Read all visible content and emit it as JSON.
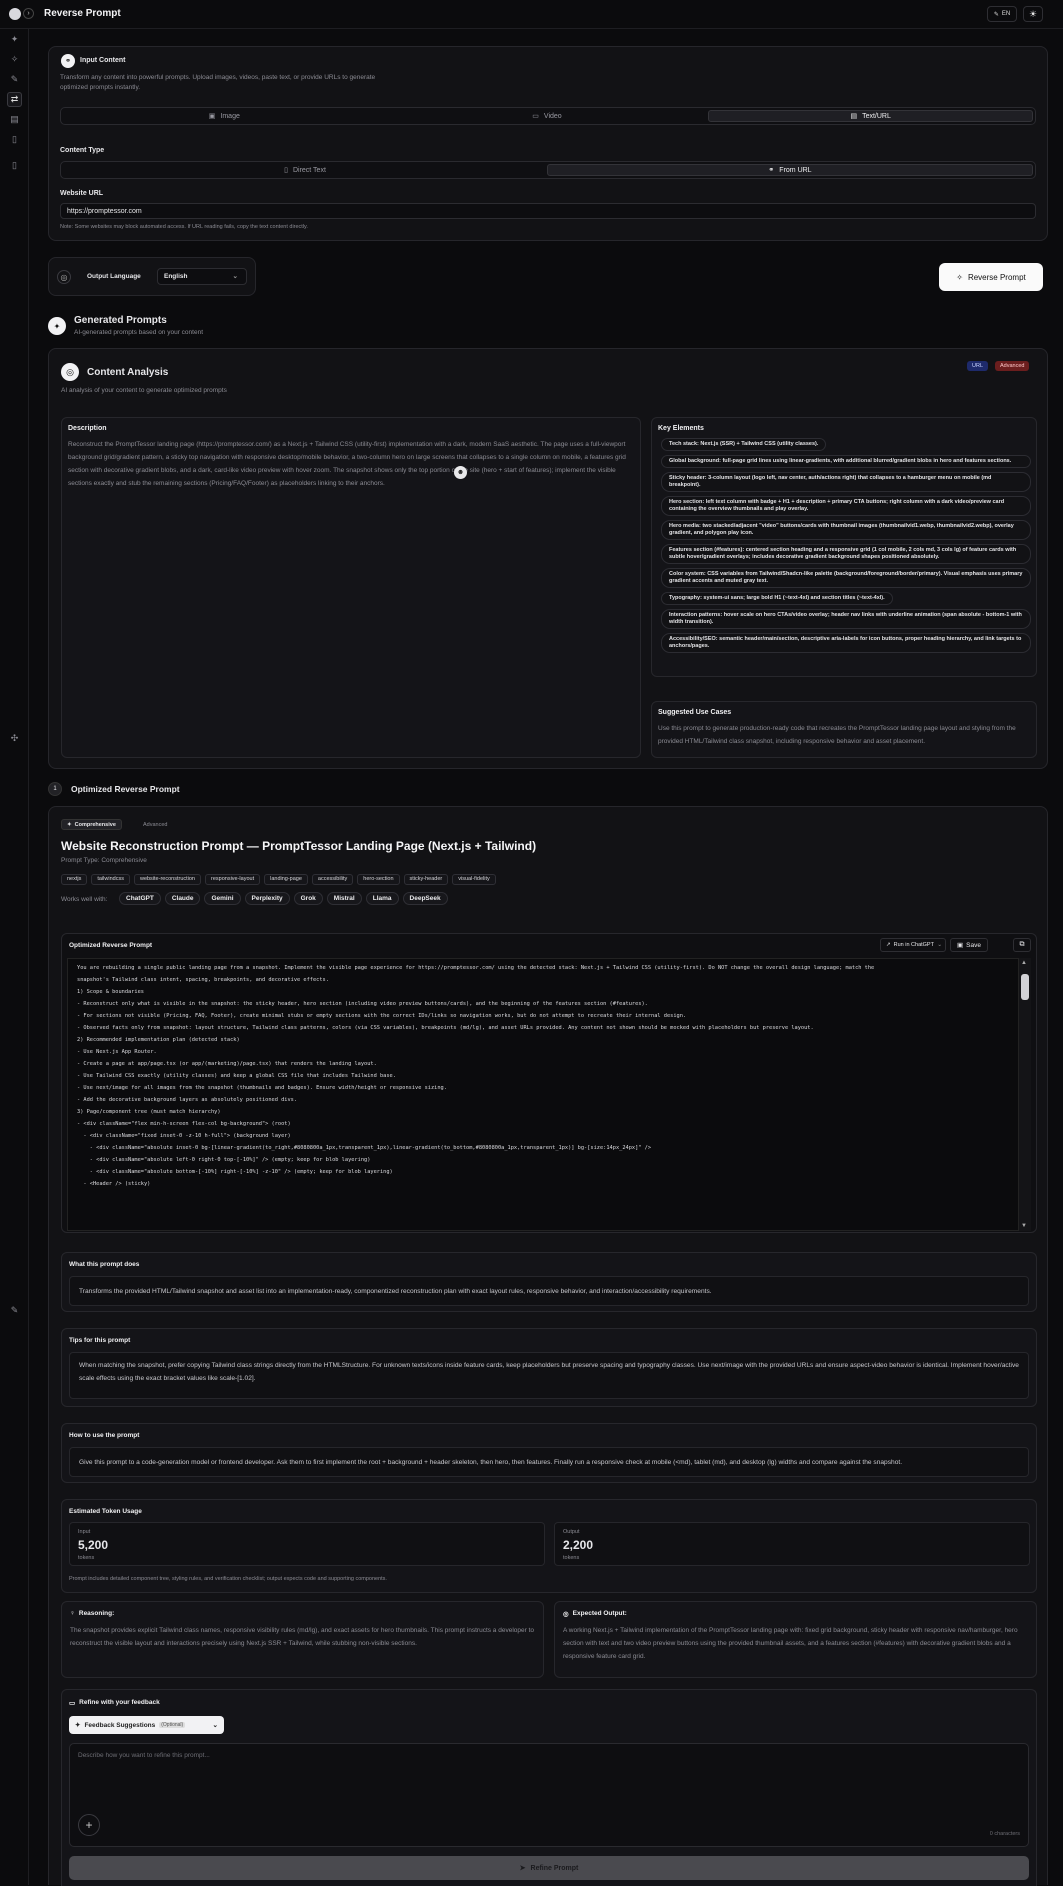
{
  "app": {
    "title": "Reverse Prompt",
    "lang_button": "EN"
  },
  "input_content": {
    "title": "Input Content",
    "description": "Transform any content into powerful prompts. Upload images, videos, paste text, or provide URLs to generate optimized prompts instantly.",
    "tabs": [
      {
        "label": "Image"
      },
      {
        "label": "Video"
      },
      {
        "label": "Text/URL"
      }
    ],
    "content_type_label": "Content Type",
    "content_type_tabs": [
      {
        "label": "Direct Text"
      },
      {
        "label": "From URL"
      }
    ],
    "website_url_label": "Website URL",
    "website_url_value": "https://promptessor.com",
    "note": "Note: Some websites may block automated access. If URL reading fails, copy the text content directly."
  },
  "output_language": {
    "label": "Output Language",
    "value": "English"
  },
  "reverse_button": "Reverse Prompt",
  "generated": {
    "title": "Generated Prompts",
    "subtitle": "AI-generated prompts based on your content"
  },
  "analysis": {
    "title": "Content Analysis",
    "subtitle": "AI analysis of your content to generate optimized prompts",
    "badges": [
      {
        "label": "URL"
      },
      {
        "label": "Advanced"
      }
    ],
    "description_title": "Description",
    "description": "Reconstruct the PromptTessor landing page (https://promptessor.com/) as a Next.js + Tailwind CSS (utility-first) implementation with a dark, modern SaaS aesthetic. The page uses a full-viewport background grid/gradient pattern, a sticky top navigation with responsive desktop/mobile behavior, a two-column hero on large screens that collapses to a single column on mobile, a features grid section with decorative gradient blobs, and a dark, card-like video preview with hover zoom. The snapshot shows only the top portion of the site (hero + start of features); implement the visible sections exactly and stub the remaining sections (Pricing/FAQ/Footer) as placeholders linking to their anchors.",
    "key_elements_title": "Key Elements",
    "key_elements": [
      "Tech stack: Next.js (SSR) + Tailwind CSS (utility classes).",
      "Global background: full-page grid lines using linear-gradients, with additional blurred/gradient blobs in hero and features sections.",
      "Sticky header: 3-column layout (logo left, nav center, auth/actions right) that collapses to a hamburger menu on mobile (md breakpoint).",
      "Hero section: left text column with badge + H1 + description + primary CTA buttons; right column with a dark video/preview card containing the overview thumbnails and play overlay.",
      "Hero media: two stacked/adjacent \"video\" buttons/cards with thumbnail images (thumbnailvid1.webp, thumbnailvid2.webp), overlay gradient, and polygon play icon.",
      "Features section (#features): centered section heading and a responsive grid (1 col mobile, 2 cols md, 3 cols lg) of feature cards with subtle hover/gradient overlays; includes decorative gradient background shapes positioned absolutely.",
      "Color system: CSS variables from Tailwind/Shadcn-like palette (background/foreground/border/primary). Visual emphasis uses primary gradient accents and muted gray text.",
      "Typography: system-ui sans; large bold H1 (~text-4xl) and section titles (~text-4xl).",
      "Interaction patterns: hover scale on hero CTAs/video overlay; header nav links with underline animation (span absolute - bottom-1 with width transition).",
      "Accessibility/SEO: semantic header/main/section, descriptive aria-labels for icon buttons, proper heading hierarchy, and link targets to anchors/pages."
    ],
    "use_cases_title": "Suggested Use Cases",
    "use_cases": "Use this prompt to generate production-ready code that recreates the PromptTessor landing page layout and styling from the provided HTML/Tailwind class snapshot, including responsive behavior and asset placement."
  },
  "optimized": {
    "number": "1",
    "title": "Optimized Reverse Prompt",
    "tabs": [
      {
        "label": "Comprehensive"
      },
      {
        "label": "Advanced"
      }
    ],
    "prompt_title": "Website Reconstruction Prompt — PromptTessor Landing Page (Next.js + Tailwind)",
    "prompt_type": "Prompt Type: Comprehensive",
    "tags": [
      "nextjs",
      "tailwindcss",
      "website-reconstruction",
      "responsive-layout",
      "landing-page",
      "accessibility",
      "hero-section",
      "sticky-header",
      "visual-fidelity"
    ],
    "works_with_label": "Works well with:",
    "models": [
      "ChatGPT",
      "Claude",
      "Gemini",
      "Perplexity",
      "Grok",
      "Mistral",
      "Llama",
      "DeepSeek"
    ],
    "box_title": "Optimized Reverse Prompt",
    "run_label": "Run in ChatGPT",
    "save_label": "Save",
    "code_lines": [
      "You are rebuilding a single public landing page from a snapshot. Implement the visible page experience for https://promptessor.com/ using the detected stack: Next.js + Tailwind CSS (utility-first). Do NOT change the overall design language; match the",
      "snapshot's Tailwind class intent, spacing, breakpoints, and decorative effects.",
      "",
      "1) Scope & boundaries",
      "- Reconstruct only what is visible in the snapshot: the sticky header, hero section (including video preview buttons/cards), and the beginning of the features section (#features).",
      "- For sections not visible (Pricing, FAQ, Footer), create minimal stubs or empty sections with the correct IDs/links so navigation works, but do not attempt to recreate their internal design.",
      "- Observed facts only from snapshot: layout structure, Tailwind class patterns, colors (via CSS variables), breakpoints (md/lg), and asset URLs provided. Any content not shown should be mocked with placeholders but preserve layout.",
      "",
      "2) Recommended implementation plan (detected stack)",
      "- Use Next.js App Router.",
      "- Create a page at app/page.tsx (or app/(marketing)/page.tsx) that renders the landing layout.",
      "- Use Tailwind CSS exactly (utility classes) and keep a global CSS file that includes Tailwind base.",
      "- Use next/image for all images from the snapshot (thumbnails and badges). Ensure width/height or responsive sizing.",
      "- Add the decorative background layers as absolutely positioned divs.",
      "",
      "3) Page/component tree (must match hierarchy)",
      "- <div className=\"flex min-h-screen flex-col bg-background\"> (root)",
      "  - <div className=\"fixed inset-0 -z-10 h-full\"> (background layer)",
      "    - <div className=\"absolute inset-0 bg-[linear-gradient(to_right,#8080800a_1px,transparent_1px),linear-gradient(to_bottom,#8080800a_1px,transparent_1px)] bg-[size:14px_24px]\" />",
      "    - <div className=\"absolute left-0 right-0 top-[-10%]\" /> (empty; keep for blob layering)",
      "    - <div className=\"absolute bottom-[-10%] right-[-10%] -z-10\" /> (empty; keep for blob layering)",
      "  - <Header /> (sticky)"
    ],
    "what_title": "What this prompt does",
    "what_text": "Transforms the provided HTML/Tailwind snapshot and asset list into an implementation-ready, componentized reconstruction plan with exact layout rules, responsive behavior, and interaction/accessibility requirements.",
    "tips_title": "Tips for this prompt",
    "tips_text": "When matching the snapshot, prefer copying Tailwind class strings directly from the HTMLStructure. For unknown texts/icons inside feature cards, keep placeholders but preserve spacing and typography classes. Use next/image with the provided URLs and ensure aspect-video behavior is identical. Implement hover/active scale effects using the exact bracket values like scale-[1.02].",
    "howto_title": "How to use the prompt",
    "howto_text": "Give this prompt to a code-generation model or frontend developer. Ask them to first implement the root + background + header skeleton, then hero, then features. Finally run a responsive check at mobile (<md), tablet (md), and desktop (lg) widths and compare against the snapshot.",
    "tokens_title": "Estimated Token Usage",
    "input_label": "Input",
    "input_value": "5,200",
    "output_label": "Output",
    "output_value": "2,200",
    "tokens_unit": "tokens",
    "tokens_note": "Prompt includes detailed component tree, styling rules, and verification checklist; output expects code and supporting components.",
    "reasoning_title": "Reasoning:",
    "reasoning_text": "The snapshot provides explicit Tailwind class names, responsive visibility rules (md/lg), and exact assets for hero thumbnails. This prompt instructs a developer to reconstruct the visible layout and interactions precisely using Next.js SSR + Tailwind, while stubbing non-visible sections.",
    "expected_title": "Expected Output:",
    "expected_text": "A working Next.js + Tailwind implementation of the PromptTessor landing page with: fixed grid background, sticky header with responsive nav/hamburger, hero section with text and two video preview buttons using the provided thumbnail assets, and a features section (#features) with decorative gradient blobs and a responsive feature card grid."
  },
  "refine": {
    "title": "Refine with your feedback",
    "suggestions_label": "Feedback Suggestions",
    "optional": "(Optional)",
    "placeholder": "Describe how you want to refine this prompt...",
    "chars": "0 characters",
    "button": "Refine Prompt"
  }
}
